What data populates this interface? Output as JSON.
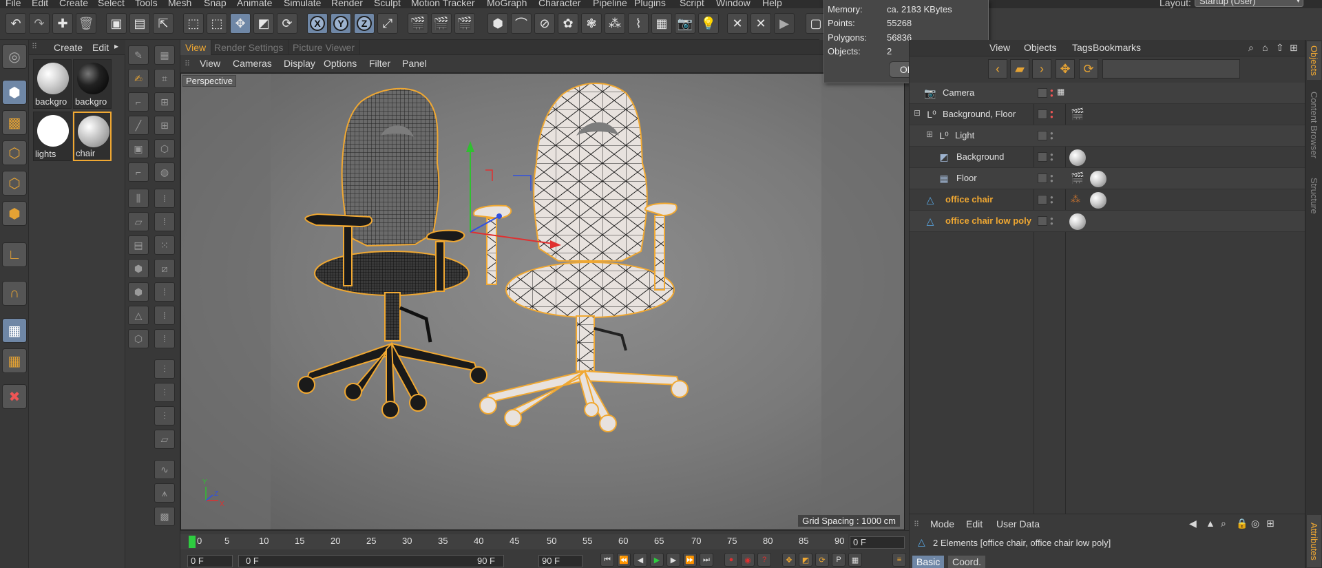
{
  "menubar": {
    "items": [
      "File",
      "Edit",
      "Create",
      "Select",
      "Tools",
      "Mesh",
      "Snap",
      "Animate",
      "Simulate",
      "Render",
      "Sculpt",
      "Motion Tracker",
      "MoGraph",
      "Character",
      "Pipeline",
      "Plugins",
      "Script",
      "Window",
      "Help"
    ],
    "layout_label": "Layout:",
    "layout_value": "Startup (User)"
  },
  "toolbar": {
    "axis_x": "X",
    "axis_y": "Y",
    "axis_z": "Z"
  },
  "material_manager": {
    "menu": [
      "Create",
      "Edit"
    ],
    "materials": [
      {
        "label": "backgro",
        "color": "#d9d9d9"
      },
      {
        "label": "backgro",
        "color": "#222222"
      },
      {
        "label": "lights",
        "color": "#ffffff"
      },
      {
        "label": "chair",
        "color": "#cfcfcf"
      }
    ]
  },
  "viewport": {
    "tabs": [
      "View",
      "Render Settings",
      "Picture Viewer"
    ],
    "menu": [
      "View",
      "Cameras",
      "Display",
      "Options",
      "Filter",
      "Panel"
    ],
    "camera_label": "Perspective",
    "grid_spacing": "Grid Spacing : 1000 cm"
  },
  "info_popup": {
    "rows": [
      {
        "key": "Memory:",
        "value": "ca. 2183 KBytes"
      },
      {
        "key": "Points:",
        "value": "55268"
      },
      {
        "key": "Polygons:",
        "value": "56836"
      },
      {
        "key": "Objects:",
        "value": "2"
      }
    ],
    "ok_label": "OK"
  },
  "object_manager": {
    "tabs": [
      "View",
      "Objects",
      "Tags",
      "Bookmarks"
    ],
    "objects": [
      {
        "name": "Camera",
        "icon": "camera-icon",
        "selected": false
      },
      {
        "name": "Background, Floor",
        "icon": "null-group-icon",
        "selected": false
      },
      {
        "name": "Light",
        "icon": "null-group-icon",
        "selected": false
      },
      {
        "name": "Background",
        "icon": "background-object-icon",
        "selected": false
      },
      {
        "name": "Floor",
        "icon": "floor-object-icon",
        "selected": false
      },
      {
        "name": "office chair",
        "icon": "polygon-object-icon",
        "selected": true
      },
      {
        "name": "office chair low poly",
        "icon": "polygon-object-icon",
        "selected": true
      }
    ]
  },
  "attributes": {
    "menu": [
      "Mode",
      "Edit",
      "User Data"
    ],
    "info": "2 Elements [office chair, office chair low poly]",
    "tabs": [
      "Basic",
      "Coord."
    ]
  },
  "timeline": {
    "ticks": [
      "0",
      "5",
      "10",
      "15",
      "20",
      "25",
      "30",
      "35",
      "40",
      "45",
      "50",
      "55",
      "60",
      "65",
      "70",
      "75",
      "80",
      "85",
      "90"
    ],
    "current_frame": "0 F",
    "start_frame": "0 F",
    "range_start": "0 F",
    "range_end": "90 F",
    "end_frame": "90 F"
  },
  "side_tabs": [
    "Objects",
    "Content Browser",
    "Structure",
    "Attributes"
  ],
  "colors": {
    "accent": "#f0a832",
    "selection_blue": "#6f87a6",
    "axis_x": "#e03030",
    "axis_y": "#30c030",
    "axis_z": "#3050e0"
  }
}
